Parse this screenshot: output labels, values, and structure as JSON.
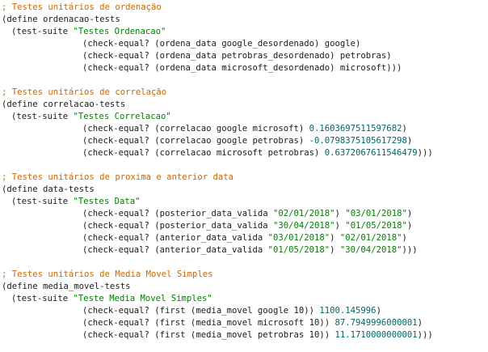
{
  "blocks": [
    {
      "comment": "; Testes unitários de ordenação",
      "define": "(define ordenacao-tests",
      "suite_open": "(test-suite ",
      "suite_name": "\"Testes Ordenacao\"",
      "checks": [
        {
          "code": "(check-equal? (ordena_data google_desordenado) google)",
          "tail": ""
        },
        {
          "code": "(check-equal? (ordena_data petrobras_desordenado) petrobras)",
          "tail": ""
        },
        {
          "code": "(check-equal? (ordena_data microsoft_desordenado) microsoft)))",
          "tail": ""
        }
      ]
    },
    {
      "comment": "; Testes unitários de correlação",
      "define": "(define correlacao-tests",
      "suite_open": "(test-suite ",
      "suite_name": "\"Testes Correlacao\"",
      "checks": [
        {
          "code": "(check-equal? (correlacao google microsoft) ",
          "num": "0.1603697511597682",
          "tail": ")"
        },
        {
          "code": "(check-equal? (correlacao google petrobras) ",
          "num": "-0.0798375105617298",
          "tail": ")"
        },
        {
          "code": "(check-equal? (correlacao microsoft petrobras) ",
          "num": "0.6372067611546479",
          "tail": ")))"
        }
      ]
    },
    {
      "comment": "; Testes unitários de proxima e anterior data",
      "define": "(define data-tests",
      "suite_open": "(test-suite ",
      "suite_name": "\"Testes Data\"",
      "checks": [
        {
          "code": "(check-equal? (posterior_data_valida ",
          "s1": "\"02/01/2018\"",
          "mid": ") ",
          "s2": "\"03/01/2018\"",
          "tail": ")"
        },
        {
          "code": "(check-equal? (posterior_data_valida ",
          "s1": "\"30/04/2018\"",
          "mid": ") ",
          "s2": "\"01/05/2018\"",
          "tail": ")"
        },
        {
          "code": "(check-equal? (anterior_data_valida ",
          "s1": "\"03/01/2018\"",
          "mid": ") ",
          "s2": "\"02/01/2018\"",
          "tail": ")"
        },
        {
          "code": "(check-equal? (anterior_data_valida ",
          "s1": "\"01/05/2018\"",
          "mid": ") ",
          "s2": "\"30/04/2018\"",
          "tail": ")))"
        }
      ]
    },
    {
      "comment": "; Testes unitários de Media Movel Simples",
      "define": "(define media_movel-tests",
      "suite_open": "(test-suite ",
      "suite_name": "\"Teste Media Movel Simples\"",
      "checks": [
        {
          "code": "(check-equal? (first (media_movel google 10)) ",
          "num": "1100.145996",
          "tail": ")"
        },
        {
          "code": "(check-equal? (first (media_movel microsoft 10)) ",
          "num": "87.7949996000001",
          "tail": ")"
        },
        {
          "code": "(check-equal? (first (media_movel petrobras 10)) ",
          "num": "11.1710000000001",
          "tail": ")))"
        }
      ]
    }
  ],
  "colors": {
    "comment": "#cc6600",
    "string": "#008000",
    "number": "#006666",
    "text": "#1a1a1a"
  }
}
